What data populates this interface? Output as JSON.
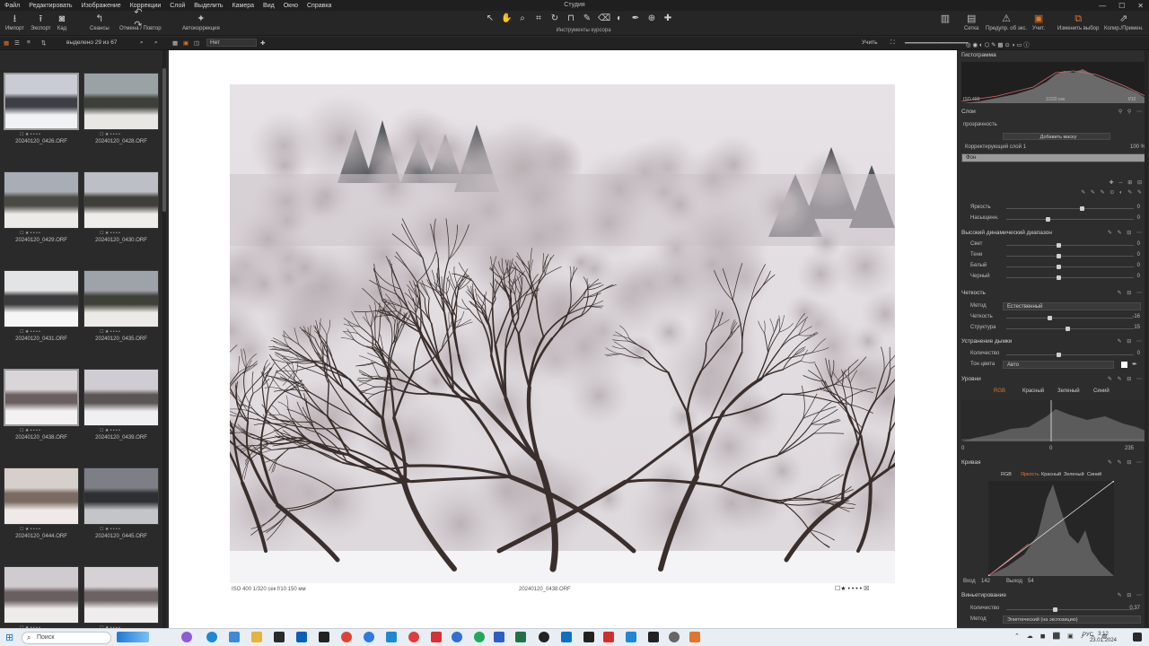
{
  "app": {
    "title": "Студия",
    "menu": [
      "Файл",
      "Редактировать",
      "Изображение",
      "Коррекции",
      "Слой",
      "Выделить",
      "Камера",
      "Вид",
      "Окно",
      "Справка"
    ]
  },
  "toolbar": {
    "import": "Импорт",
    "export": "Экспорт",
    "kad": "Кад",
    "sessions": "Сеансы",
    "undo_redo": "Отмена / Повтор",
    "autocorrect": "Автокоррекция",
    "cursor_tools_label": "Инструменты курсора",
    "right_tools": [
      "Сетка",
      "Предупр. об экс.",
      "Учит.",
      "Изменить выбор",
      "Копир./Примен."
    ]
  },
  "browser": {
    "count_label": "выделено 29 из 67",
    "view_select": "Нет",
    "deselect": "Учить",
    "thumbnails": [
      {
        "name": "20240120_0426.ORF"
      },
      {
        "name": "20240120_0428.ORF"
      },
      {
        "name": "20240120_0429.ORF"
      },
      {
        "name": "20240120_0430.ORF"
      },
      {
        "name": "20240120_0431.ORF"
      },
      {
        "name": "20240120_0435.ORF"
      },
      {
        "name": "20240120_0438.ORF"
      },
      {
        "name": "20240120_0439.ORF"
      },
      {
        "name": "20240120_0444.ORF"
      },
      {
        "name": "20240120_0445.ORF"
      },
      {
        "name": "",
        "sel": false
      },
      {
        "name": "",
        "sel": false
      }
    ]
  },
  "viewer": {
    "meta": "ISO 400    1/320 сек    f/10    150 мм",
    "filename": "20240120_0438.ORF",
    "rating": "☐★ • • • •  ☒"
  },
  "tools": {
    "histogram": {
      "title": "Гистограмма",
      "iso": "ISO 400",
      "shutter": "1/320 сек",
      "aperture": "f/10"
    },
    "layers": {
      "title": "Слои",
      "opacity_label": "прозрачность",
      "add_mask": "Добавить маску",
      "layer1": "Корректирующий слой 1",
      "layer2": "Фон",
      "pct": "100 %"
    },
    "brightness": {
      "label": "Яркость",
      "value": "0"
    },
    "saturation": {
      "label": "Насыщенн.",
      "value": "0"
    },
    "hdr": {
      "title": "Высокий динамический диапазон",
      "rows": [
        {
          "label": "Свет",
          "value": "0"
        },
        {
          "label": "Тени",
          "value": "0"
        },
        {
          "label": "Белый",
          "value": "0"
        },
        {
          "label": "Черный",
          "value": "0"
        }
      ]
    },
    "clarity": {
      "title": "Четкость",
      "method_label": "Метод",
      "method": "Естественный",
      "clarity_label": "Четкость",
      "clarity_value": "-16",
      "structure_label": "Структура",
      "structure_value": "15"
    },
    "dehaze": {
      "title": "Устранение дымки",
      "amount_label": "Количество",
      "amount_value": "0",
      "tone_label": "Тон цвета",
      "tone": "Авто"
    },
    "levels": {
      "title": "Уровни",
      "tabs": [
        "RGB",
        "Красный",
        "Зеленый",
        "Синий"
      ],
      "low": "0",
      "mid": "0",
      "high": "235"
    },
    "curves": {
      "title": "Кривая",
      "tabs": [
        "RGB",
        "Яркость",
        "Красный",
        "Зеленый",
        "Синий"
      ],
      "input_label": "Вход",
      "input": "142",
      "output_label": "Выход",
      "output": "54"
    },
    "vignette": {
      "title": "Виньетирование",
      "amount_label": "Количество",
      "amount_value": "0.37",
      "method_label": "Метод",
      "method": "Элиптический (на экспозицию)"
    }
  },
  "taskbar": {
    "search_placeholder": "Поиск",
    "time": "3:12",
    "date": "23.01.2024",
    "lang": "РУС"
  }
}
